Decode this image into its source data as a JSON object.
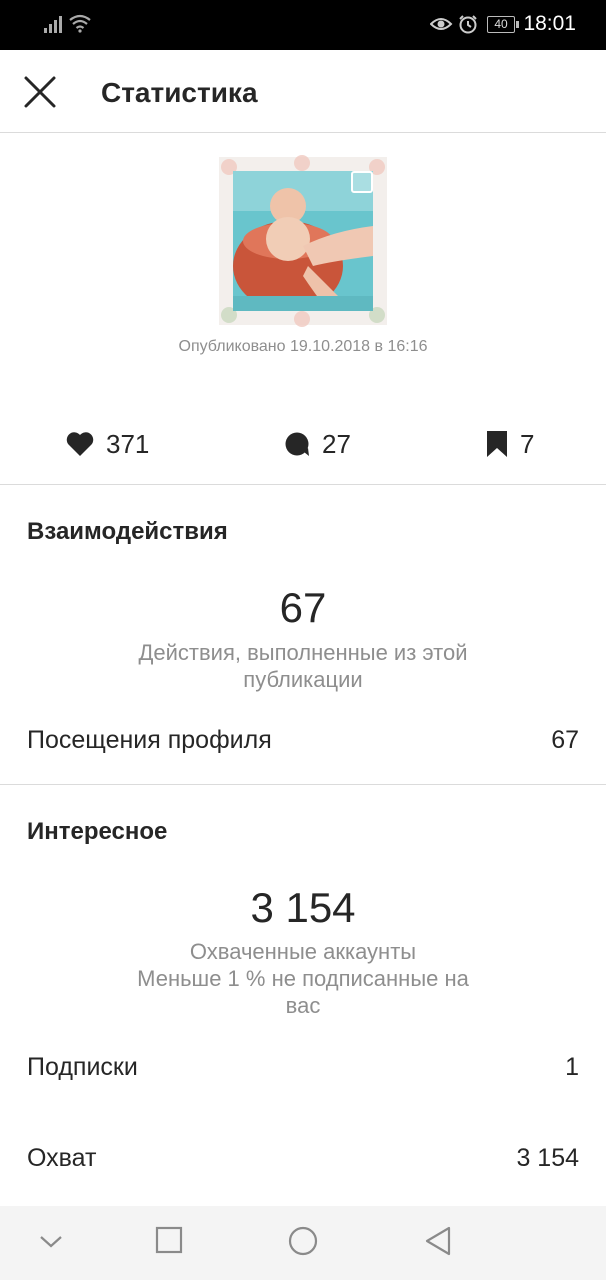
{
  "status_bar": {
    "time": "18:01",
    "battery": "40",
    "icons": [
      "signal-icon",
      "wifi-icon",
      "eye-icon",
      "alarm-icon",
      "battery-icon"
    ]
  },
  "header": {
    "title": "Статистика",
    "close_icon": "close-icon"
  },
  "post": {
    "published": "Опубликовано 19.10.2018 в 16:16"
  },
  "metrics": {
    "likes": "371",
    "comments": "27",
    "saves": "7"
  },
  "interactions": {
    "title": "Взаимодействия",
    "value": "67",
    "caption_line1": "Действия, выполненные из этой",
    "caption_line2": "публикации",
    "profile_visits_label": "Посещения профиля",
    "profile_visits_value": "67"
  },
  "discovery": {
    "title": "Интересное",
    "value": "3 154",
    "caption_line1": "Охваченные аккаунты",
    "caption_line2": "Меньше 1 % не подписанные на",
    "caption_line3": "вас",
    "follows_label": "Подписки",
    "follows_value": "1",
    "reach_label": "Охват",
    "reach_value": "3 154"
  },
  "nav": {
    "icons": [
      "chevron-down-icon",
      "recents-square-icon",
      "home-circle-icon",
      "back-triangle-icon"
    ]
  },
  "colors": {
    "text": "#262626",
    "secondary": "#8e8e8e",
    "divider": "#dbdbdb"
  }
}
